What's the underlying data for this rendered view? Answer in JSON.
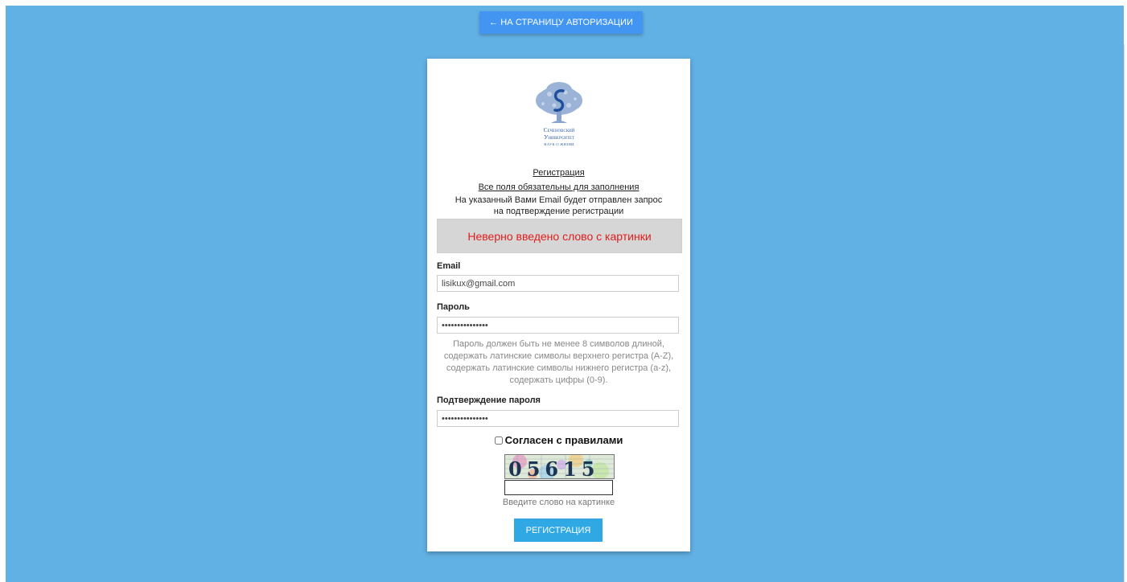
{
  "header": {
    "back_label": "← НА СТРАНИЦУ АВТОРИЗАЦИИ"
  },
  "logo": {
    "line1": "Сеченовский",
    "line2": "Университет",
    "line3": "НАУК О ЖИЗНИ"
  },
  "form": {
    "title": "Регистрация",
    "required_note": "Все поля обязательны для заполнения",
    "info_line1": "На указанный Вами Email будет отправлен запрос",
    "info_line2": "на подтверждение регистрации",
    "error_message": "Неверно введено слово с картинки",
    "email": {
      "label": "Email",
      "value": "lisikux@gmail.com"
    },
    "password": {
      "label": "Пароль",
      "value": "•••••••••••••••",
      "hint_lines": [
        "Пароль должен быть не менее 8 символов длиной,",
        "содержать латинские символы верхнего регистра (A-Z),",
        "содержать латинские символы нижнего регистра (a-z),",
        "содержать цифры (0-9)."
      ]
    },
    "confirm": {
      "label": "Подтверждение пароля",
      "value": "•••••••••••••••"
    },
    "agree_label": "Согласен с правилами",
    "captcha": {
      "text": "05615",
      "value": "",
      "hint": "Введите слово на картинке"
    },
    "submit_label": "РЕГИСТРАЦИЯ"
  },
  "colors": {
    "background": "#62b1e4",
    "back_button": "#4296f1",
    "submit_button": "#2fa8e3",
    "error_text": "#e11d1d",
    "error_box": "#d6d6d6"
  }
}
